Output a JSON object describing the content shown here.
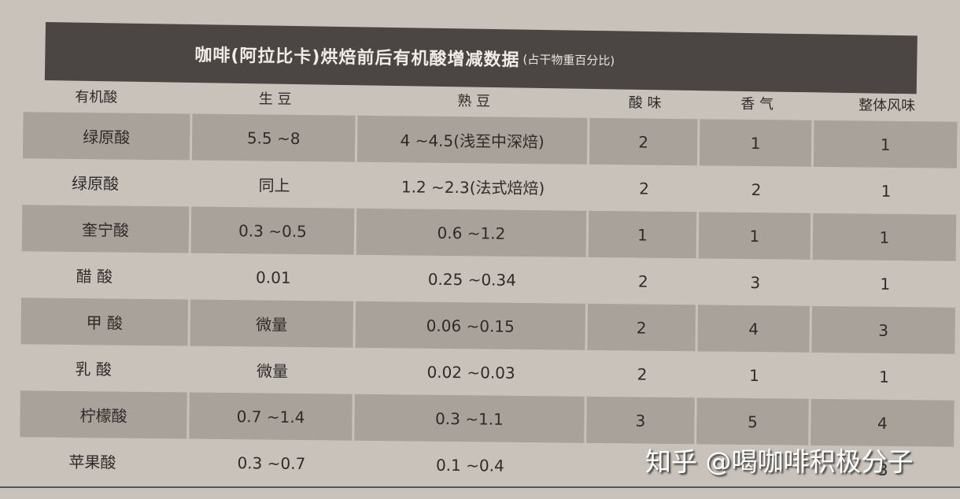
{
  "title": "咖啡(阿拉比卡)烘焙前后有机酸增减数据",
  "subtitle": "(占干物重百分比)",
  "headers": [
    "有机酸",
    "生 豆",
    "熟 豆",
    "酸 味",
    "香 气",
    "整体风味"
  ],
  "rows": [
    [
      "绿原酸",
      "5.5 ~8",
      "4 ~4.5(浅至中深焙)",
      "2",
      "1",
      "1"
    ],
    [
      "绿原酸",
      "同上",
      "1.2 ~2.3(法式焙焙)",
      "2",
      "2",
      "1"
    ],
    [
      "奎宁酸",
      "0.3 ~0.5",
      "0.6 ~1.2",
      "1",
      "1",
      "1"
    ],
    [
      "醋 酸",
      "0.01",
      "0.25 ~0.34",
      "2",
      "3",
      "1"
    ],
    [
      "甲 酸",
      "微量",
      "0.06 ~0.15",
      "2",
      "4",
      "3"
    ],
    [
      "乳 酸",
      "微量",
      "0.02 ~0.03",
      "2",
      "1",
      "1"
    ],
    [
      "柠檬酸",
      "0.7 ~1.4",
      "0.3 ~1.1",
      "3",
      "5",
      "4"
    ],
    [
      "苹果酸",
      "0.3 ~0.7",
      "0.1 ~0.4",
      "",
      "",
      "3"
    ]
  ],
  "watermark": "知乎 @喝咖啡积极分子"
}
